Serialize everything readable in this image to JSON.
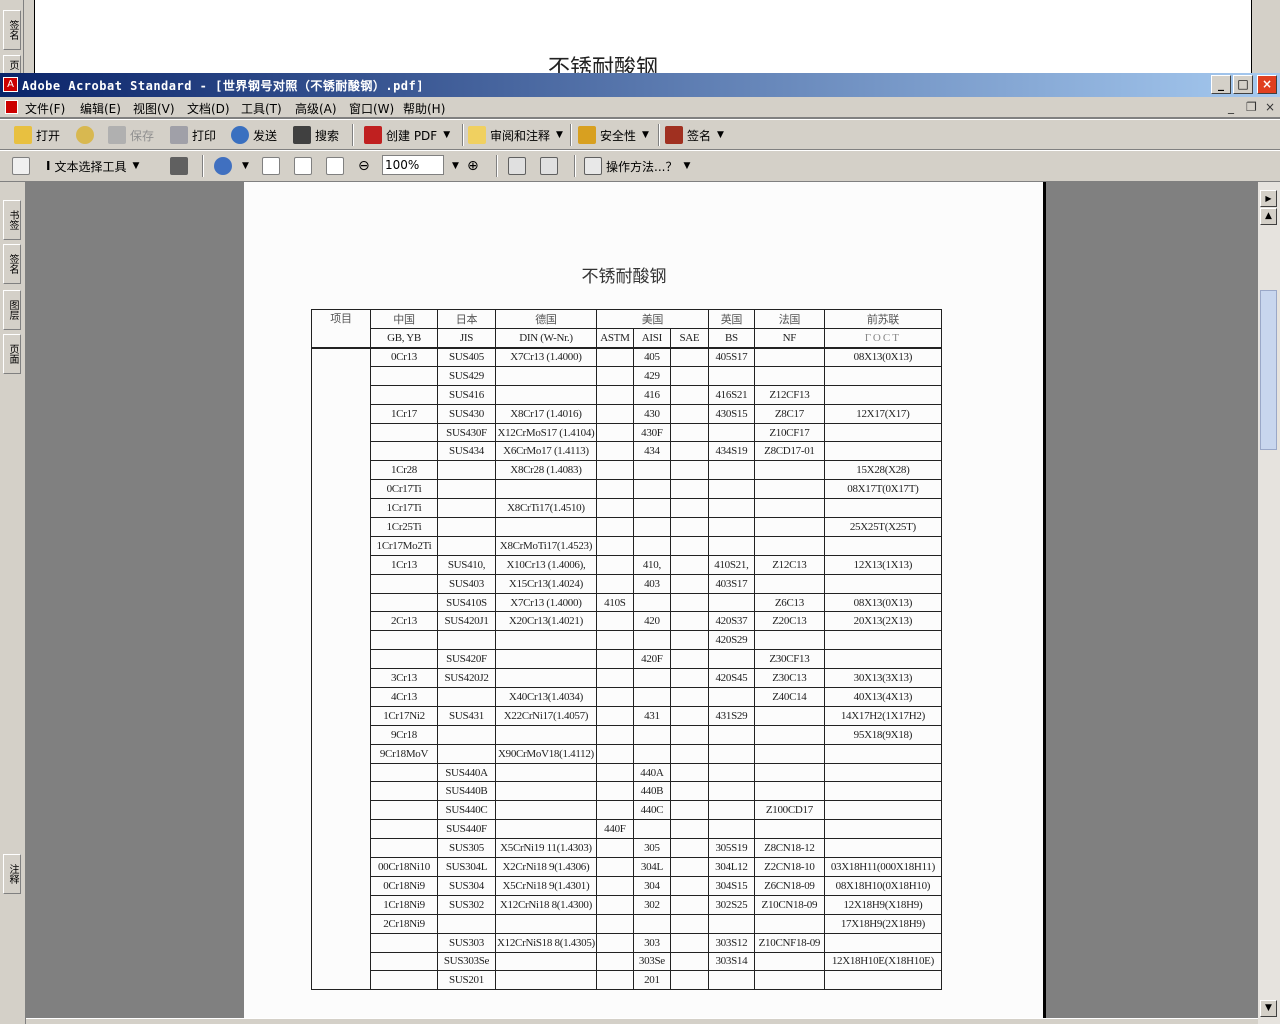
{
  "background_window": {
    "title": "不锈耐酸钢",
    "side_tabs": [
      "签名",
      "页面"
    ]
  },
  "window": {
    "title": "Adobe Acrobat Standard - [世界钢号对照（不锈耐酸钢）.pdf]",
    "controls": [
      "_",
      "□",
      "×"
    ]
  },
  "menu": [
    "文件(F)",
    "编辑(E)",
    "视图(V)",
    "文档(D)",
    "工具(T)",
    "高级(A)",
    "窗口(W)",
    "帮助(H)"
  ],
  "toolbar1": {
    "open": "打开",
    "save": "保存",
    "print": "打印",
    "send": "发送",
    "search": "搜索",
    "create_pdf": "创建 PDF",
    "review": "审阅和注释",
    "security": "安全性",
    "sign": "签名"
  },
  "toolbar2": {
    "text_select": "文本选择工具",
    "zoom": "100%",
    "howto": "操作方法...？"
  },
  "nav_tabs": [
    "书签",
    "签名",
    "图层",
    "页面",
    "注释"
  ],
  "doc": {
    "title": "不锈耐酸钢",
    "header1": {
      "item": "项目",
      "china": "中国",
      "japan": "日本",
      "germany": "德国",
      "usa": "美国",
      "uk": "英国",
      "france": "法国",
      "ussr": "前苏联"
    },
    "header2": {
      "gb": "GB, YB",
      "jis": "JIS",
      "din": "DIN (W-Nr.)",
      "astm": "ASTM",
      "aisi": "AISI",
      "sae": "SAE",
      "bs": "BS",
      "nf": "NF",
      "gost": "ГОСТ"
    },
    "rows": [
      [
        "0Cr13",
        "SUS405",
        "X7Cr13 (1.4000)",
        "",
        "405",
        "",
        "405S17",
        "",
        "08X13(0X13)"
      ],
      [
        "",
        "SUS429",
        "",
        "",
        "429",
        "",
        "",
        "",
        ""
      ],
      [
        "",
        "SUS416",
        "",
        "",
        "416",
        "",
        "416S21",
        "Z12CF13",
        ""
      ],
      [
        "1Cr17",
        "SUS430",
        "X8Cr17 (1.4016)",
        "",
        "430",
        "",
        "430S15",
        "Z8C17",
        "12X17(X17)"
      ],
      [
        "",
        "SUS430F",
        "X12CrMoS17 (1.4104)",
        "",
        "430F",
        "",
        "",
        "Z10CF17",
        ""
      ],
      [
        "",
        "SUS434",
        "X6CrMo17 (1.4113)",
        "",
        "434",
        "",
        "434S19",
        "Z8CD17-01",
        ""
      ],
      [
        "1Cr28",
        "",
        "X8Cr28 (1.4083)",
        "",
        "",
        "",
        "",
        "",
        "15X28(X28)"
      ],
      [
        "0Cr17Ti",
        "",
        "",
        "",
        "",
        "",
        "",
        "",
        "08X17T(0X17T)"
      ],
      [
        "1Cr17Ti",
        "",
        "X8CrTi17(1.4510)",
        "",
        "",
        "",
        "",
        "",
        ""
      ],
      [
        "1Cr25Ti",
        "",
        "",
        "",
        "",
        "",
        "",
        "",
        "25X25T(X25T)"
      ],
      [
        "1Cr17Mo2Ti",
        "",
        "X8CrMoTi17(1.4523)",
        "",
        "",
        "",
        "",
        "",
        ""
      ],
      [
        "1Cr13",
        "SUS410,",
        "X10Cr13 (1.4006),",
        "",
        "410,",
        "",
        "410S21,",
        "Z12C13",
        "12X13(1X13)"
      ],
      [
        "",
        "SUS403",
        "X15Cr13(1.4024)",
        "",
        "403",
        "",
        "403S17",
        "",
        ""
      ],
      [
        "",
        "SUS410S",
        "X7Cr13 (1.4000)",
        "410S",
        "",
        "",
        "",
        "Z6C13",
        "08X13(0X13)"
      ],
      [
        "2Cr13",
        "SUS420J1",
        "X20Cr13(1.4021)",
        "",
        "420",
        "",
        "420S37",
        "Z20C13",
        "20X13(2X13)"
      ],
      [
        "",
        "",
        "",
        "",
        "",
        "",
        "420S29",
        "",
        ""
      ],
      [
        "",
        "SUS420F",
        "",
        "",
        "420F",
        "",
        "",
        "Z30CF13",
        ""
      ],
      [
        "3Cr13",
        "SUS420J2",
        "",
        "",
        "",
        "",
        "420S45",
        "Z30C13",
        "30X13(3X13)"
      ],
      [
        "4Cr13",
        "",
        "X40Cr13(1.4034)",
        "",
        "",
        "",
        "",
        "Z40C14",
        "40X13(4X13)"
      ],
      [
        "1Cr17Ni2",
        "SUS431",
        "X22CrNi17(1.4057)",
        "",
        "431",
        "",
        "431S29",
        "",
        "14X17H2(1X17H2)"
      ],
      [
        "9Cr18",
        "",
        "",
        "",
        "",
        "",
        "",
        "",
        "95X18(9X18)"
      ],
      [
        "9Cr18MoV",
        "",
        "X90CrMoV18(1.4112)",
        "",
        "",
        "",
        "",
        "",
        ""
      ],
      [
        "",
        "SUS440A",
        "",
        "",
        "440A",
        "",
        "",
        "",
        ""
      ],
      [
        "",
        "SUS440B",
        "",
        "",
        "440B",
        "",
        "",
        "",
        ""
      ],
      [
        "",
        "SUS440C",
        "",
        "",
        "440C",
        "",
        "",
        "Z100CD17",
        ""
      ],
      [
        "",
        "SUS440F",
        "",
        "440F",
        "",
        "",
        "",
        "",
        ""
      ],
      [
        "",
        "SUS305",
        "X5CrNi19 11(1.4303)",
        "",
        "305",
        "",
        "305S19",
        "Z8CN18-12",
        ""
      ],
      [
        "00Cr18Ni10",
        "SUS304L",
        "X2CrNi18 9(1.4306)",
        "",
        "304L",
        "",
        "304L12",
        "Z2CN18-10",
        "03X18H11(000X18H11)"
      ],
      [
        "0Cr18Ni9",
        "SUS304",
        "X5CrNi18 9(1.4301)",
        "",
        "304",
        "",
        "304S15",
        "Z6CN18-09",
        "08X18H10(0X18H10)"
      ],
      [
        "1Cr18Ni9",
        "SUS302",
        "X12CrNi18 8(1.4300)",
        "",
        "302",
        "",
        "302S25",
        "Z10CN18-09",
        "12X18H9(X18H9)"
      ],
      [
        "2Cr18Ni9",
        "",
        "",
        "",
        "",
        "",
        "",
        "",
        "17X18H9(2X18H9)"
      ],
      [
        "",
        "SUS303",
        "X12CrNiS18 8(1.4305)",
        "",
        "303",
        "",
        "303S12",
        "Z10CNF18-09",
        ""
      ],
      [
        "",
        "SUS303Se",
        "",
        "",
        "303Se",
        "",
        "303S14",
        "",
        "12X18H10E(X18H10E)"
      ],
      [
        "",
        "SUS201",
        "",
        "",
        "201",
        "",
        "",
        "",
        ""
      ]
    ]
  }
}
